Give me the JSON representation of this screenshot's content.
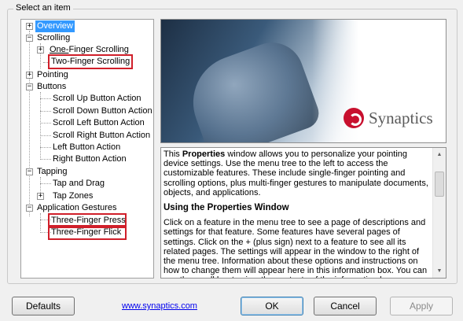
{
  "group_title": "Select an item",
  "tree": {
    "overview": "Overview",
    "scrolling": "Scrolling",
    "one_finger_scrolling_prefix": "One-",
    "one_finger_scrolling_rest": "Finger Scrolling",
    "two_finger_scrolling": "Two-Finger Scrolling",
    "pointing": "Pointing",
    "buttons": "Buttons",
    "scroll_up": "Scroll Up Button Action",
    "scroll_down": "Scroll Down Button Action",
    "scroll_left": "Scroll Left Button Action",
    "scroll_right": "Scroll Right Button Action",
    "left_button": "Left Button Action",
    "right_button": "Right Button Action",
    "tapping": "Tapping",
    "tap_and_drag": "Tap and Drag",
    "tap_zones": "Tap Zones",
    "application_gestures": "Application Gestures",
    "three_finger_press": "Three-Finger Press",
    "three_finger_flick": "Three-Finger Flick"
  },
  "banner": {
    "logo_text": "Synaptics",
    "logo_suffix": "·"
  },
  "info": {
    "p1_a": "This ",
    "p1_bold": "Properties",
    "p1_b": " window allows you to personalize your pointing device settings.  Use the menu tree to the left to access the customizable features.  These include single-finger pointing and scrolling options, plus multi-finger gestures to manipulate documents, objects, and applications.",
    "heading": "Using the Properties Window",
    "p2": "Click on a feature in the menu tree to see a page of descriptions and settings for that feature.  Some features have several pages of settings.  Click on the + (plus sign) next to a feature to see all its related pages.  The settings will appear in the window to the right of the menu tree.  Information about these options and instructions on how to change them will appear here in this information box.  You can use the scroll bar to view the contents of the information box."
  },
  "buttons": {
    "defaults": "Defaults",
    "ok": "OK",
    "cancel": "Cancel",
    "apply": "Apply"
  },
  "link": "www.synaptics.com",
  "expander_plus": "+",
  "expander_minus": "−",
  "scroll_up_glyph": "▲",
  "scroll_down_glyph": "▼"
}
